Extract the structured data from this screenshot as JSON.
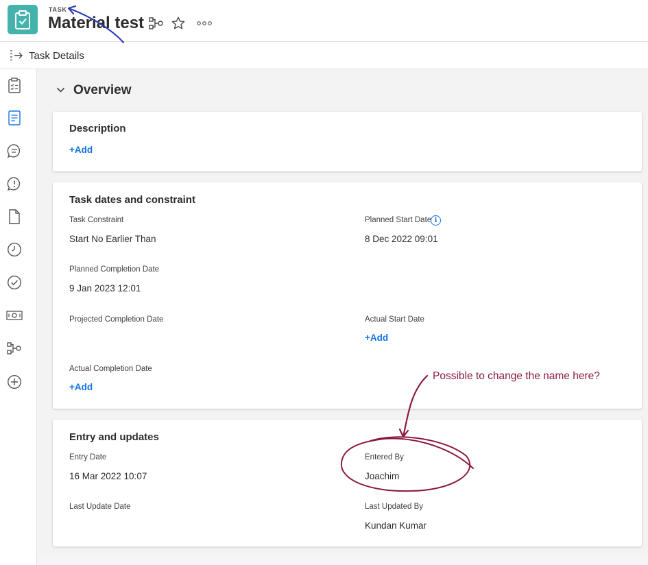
{
  "header": {
    "object_type": "TASK",
    "title": "Material test",
    "icons": {
      "object": "clipboard-check-icon",
      "hierarchy": "hierarchy-icon",
      "favorite": "star-icon",
      "more": "more-icon"
    }
  },
  "subheader": {
    "label": "Task Details",
    "icon": "panel-collapse-icon"
  },
  "leftnav": {
    "items": [
      "task-details-icon",
      "document-text-icon",
      "comment-icon",
      "issue-icon",
      "document-icon",
      "clock-icon",
      "check-circle-icon",
      "money-icon",
      "hierarchy-icon",
      "add-circle-icon"
    ]
  },
  "overview": {
    "title": "Overview"
  },
  "description": {
    "title": "Description",
    "add_label": "+Add"
  },
  "dates": {
    "title": "Task dates and constraint",
    "task_constraint_label": "Task Constraint",
    "task_constraint_value": "Start No Earlier Than",
    "planned_start_label": "Planned Start Date",
    "planned_start_value": "8 Dec 2022 09:01",
    "info_glyph": "i",
    "planned_completion_label": "Planned Completion Date",
    "planned_completion_value": "9 Jan 2023 12:01",
    "projected_completion_label": "Projected Completion Date",
    "actual_start_label": "Actual Start Date",
    "actual_start_add": "+Add",
    "actual_completion_label": "Actual Completion Date",
    "actual_completion_add": "+Add"
  },
  "entry": {
    "title": "Entry and updates",
    "entry_date_label": "Entry Date",
    "entry_date_value": "16 Mar 2022 10:07",
    "entered_by_label": "Entered By",
    "entered_by_value": "Joachim",
    "last_update_label": "Last Update Date",
    "last_updated_by_label": "Last Updated By",
    "last_updated_by_value": "Kundan Kumar"
  },
  "annotation": {
    "text": "Possible to change the name here?",
    "color": "#8b1a3d",
    "arrow_color": "#2d3bb5"
  },
  "colors": {
    "accent": "#1473e6",
    "task_icon_bg": "#44b3ac"
  }
}
